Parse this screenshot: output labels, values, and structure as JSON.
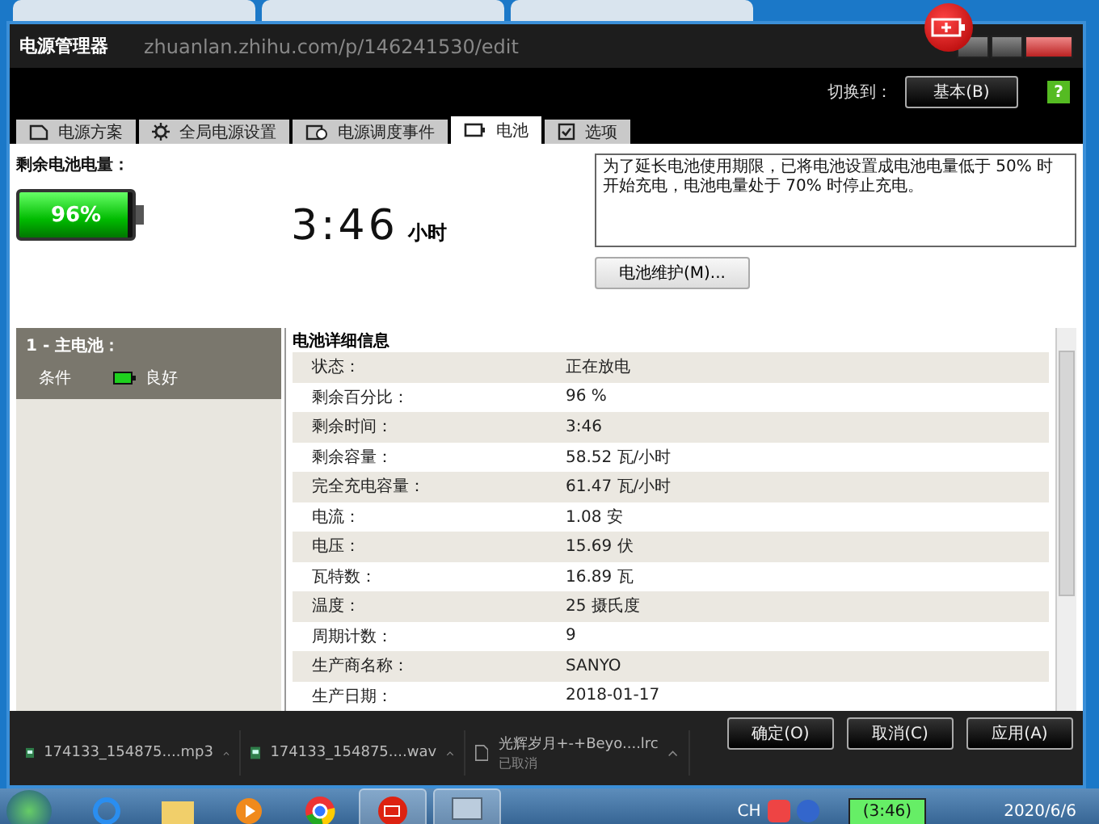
{
  "browser": {
    "address": "zhuanlan.zhihu.com/p/146241530/edit"
  },
  "window": {
    "title": "电源管理器"
  },
  "switcher": {
    "label": "切换到：",
    "button": "基本(B)",
    "help": "?"
  },
  "tabs": [
    {
      "label": "电源方案",
      "kind": "document",
      "selected": false
    },
    {
      "label": "全局电源设置",
      "kind": "gear",
      "selected": false
    },
    {
      "label": "电源调度事件",
      "kind": "clock",
      "selected": false
    },
    {
      "label": "电池",
      "kind": "battery",
      "selected": true
    },
    {
      "label": "选项",
      "kind": "checkbox",
      "selected": false
    }
  ],
  "summary": {
    "label": "剩余电池电量：",
    "percent": "96%",
    "level": 0.96,
    "time": "3:46",
    "time_unit": "小时",
    "notice": "为了延长电池使用期限，已将电池设置成电池电量低于 50% 时开始充电，电池电量处于 70% 时停止充电。",
    "maintenance_button": "电池维护(M)..."
  },
  "battery_list": {
    "title": "1 - 主电池：",
    "condition_label": "条件",
    "condition_value": "良好"
  },
  "details": {
    "title": "电池详细信息",
    "rows": [
      {
        "label": "状态：",
        "value": "正在放电"
      },
      {
        "label": "剩余百分比：",
        "value": "96 %"
      },
      {
        "label": "剩余时间：",
        "value": "3:46"
      },
      {
        "label": "剩余容量：",
        "value": "58.52 瓦/小时"
      },
      {
        "label": "完全充电容量：",
        "value": "61.47 瓦/小时"
      },
      {
        "label": "电流：",
        "value": "1.08 安"
      },
      {
        "label": "电压：",
        "value": "15.69 伏"
      },
      {
        "label": "瓦特数：",
        "value": "16.89 瓦"
      },
      {
        "label": "温度：",
        "value": "25 摄氏度"
      },
      {
        "label": "周期计数：",
        "value": "9"
      },
      {
        "label": "生产商名称：",
        "value": "SANYO"
      },
      {
        "label": "生产日期：",
        "value": "2018-01-17"
      }
    ]
  },
  "buttons": [
    "确定(O)",
    "取消(C)",
    "应用(A)"
  ],
  "downloads": [
    {
      "name": "174133_154875....mp3",
      "kind": "audio"
    },
    {
      "name": "174133_154875....wav",
      "kind": "audio"
    },
    {
      "name": "光辉岁月+-+Beyo....lrc",
      "status": "已取消",
      "kind": "file"
    }
  ],
  "taskbar": {
    "language": "CH",
    "battery_time": "(3:46)",
    "date": "2020/6/6"
  }
}
